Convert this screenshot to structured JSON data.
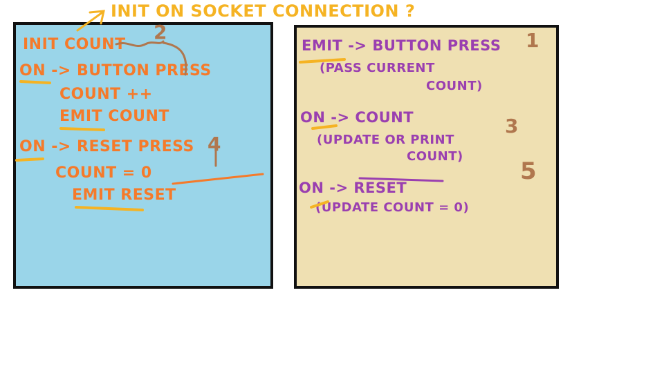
{
  "header": {
    "title": "INIT ON SOCKET CONNECTION ?"
  },
  "server_panel": {
    "lines": [
      "INIT COUNT",
      "ON -> BUTTON PRESS",
      "COUNT ++",
      "EMIT COUNT",
      "ON -> RESET PRESS",
      "COUNT = 0",
      "EMIT RESET"
    ],
    "step_numbers": [
      "2",
      "4"
    ]
  },
  "client_panel": {
    "lines": [
      "EMIT -> BUTTON PRESS",
      "(PASS CURRENT",
      "COUNT)",
      "ON -> COUNT",
      "(UPDATE OR PRINT",
      "COUNT)",
      "ON -> RESET",
      "(UPDATE COUNT = 0)"
    ],
    "step_numbers": [
      "1",
      "3",
      "5"
    ]
  },
  "colors": {
    "server_bg": "#9ad5e9",
    "client_bg": "#efe0b2",
    "server_ink": "#f57a2a",
    "client_ink": "#9a3fb0",
    "title_ink": "#f5b323",
    "number_ink": "#b0774e",
    "underline_ink": "#f5b323"
  }
}
